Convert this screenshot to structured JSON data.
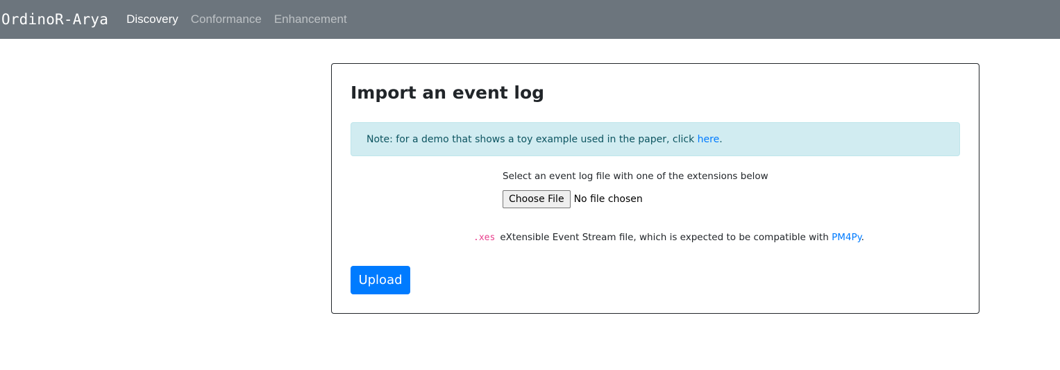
{
  "navbar": {
    "brand": "OrdinoR-Arya",
    "links": [
      {
        "label": "Discovery",
        "active": true
      },
      {
        "label": "Conformance",
        "active": false
      },
      {
        "label": "Enhancement",
        "active": false
      }
    ]
  },
  "card": {
    "title": "Import an event log",
    "alert": {
      "text": "Note: for a demo that shows a toy example used in the paper, click ",
      "link": "here",
      "suffix": "."
    },
    "select_label": "Select an event log file with one of the extensions below",
    "file_input": {
      "button_label": "Choose File",
      "status": "No file chosen"
    },
    "extension": {
      "code": ".xes",
      "description": "eXtensible Event Stream file, which is expected to be compatible with ",
      "link": "PM4Py",
      "suffix": "."
    },
    "upload_label": "Upload"
  },
  "colors": {
    "navbar_bg": "#6c757d",
    "primary": "#007bff",
    "alert_bg": "#d1ecf1",
    "alert_text": "#0c5460",
    "code": "#e83e8c"
  }
}
